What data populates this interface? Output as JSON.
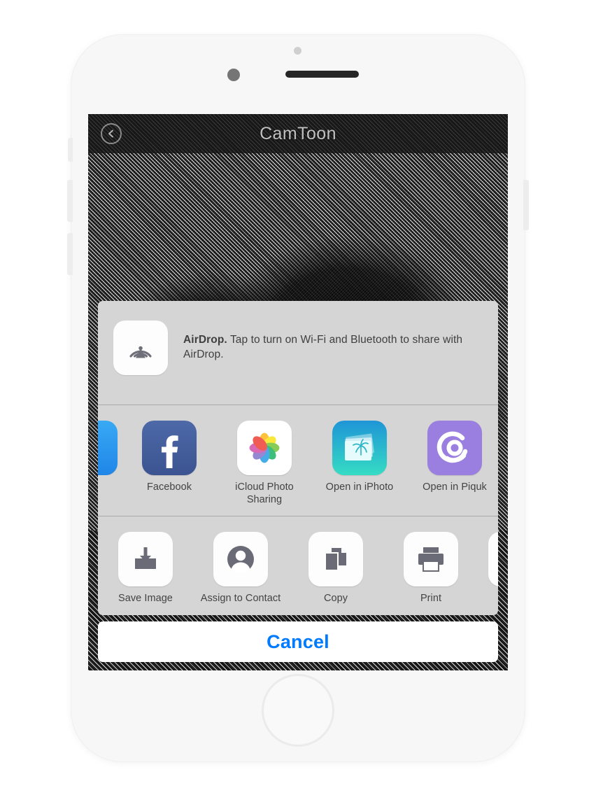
{
  "device": {
    "type": "white-smartphone",
    "components": [
      "sensor-dot",
      "front-camera",
      "earpiece-speaker",
      "home-button",
      "silent-switch",
      "volume-up",
      "volume-down",
      "power-button"
    ]
  },
  "app": {
    "nav": {
      "title": "CamToon",
      "back_icon": "back-arrow-icon"
    },
    "photo": {
      "description": "Black and white halftone comic-style photo of palm trees"
    }
  },
  "share_sheet": {
    "airdrop": {
      "icon": "airdrop-icon",
      "title": "AirDrop.",
      "message": " Tap to turn on Wi-Fi and Bluetooth to share with AirDrop."
    },
    "apps": [
      {
        "label": "Facebook",
        "icon": "facebook-icon",
        "style": "facebook"
      },
      {
        "label": "iCloud Photo Sharing",
        "icon": "photos-flower-icon",
        "style": "photos"
      },
      {
        "label": "Open in iPhoto",
        "icon": "iphoto-icon",
        "style": "iphoto"
      },
      {
        "label": "Open in Piquk",
        "icon": "piquk-icon",
        "style": "piquk"
      }
    ],
    "actions": [
      {
        "label": "Save Image",
        "icon": "save-image-icon"
      },
      {
        "label": "Assign to Contact",
        "icon": "contact-icon"
      },
      {
        "label": "Copy",
        "icon": "copy-icon"
      },
      {
        "label": "Print",
        "icon": "print-icon"
      }
    ],
    "cancel_label": "Cancel"
  },
  "colors": {
    "cancel_blue": "#007aff",
    "sheet_background": "#d5d5d5",
    "action_icon_gray": "#6b6b78",
    "facebook_blue": "#3b5491",
    "piquk_purple": "#9b7fe0"
  }
}
